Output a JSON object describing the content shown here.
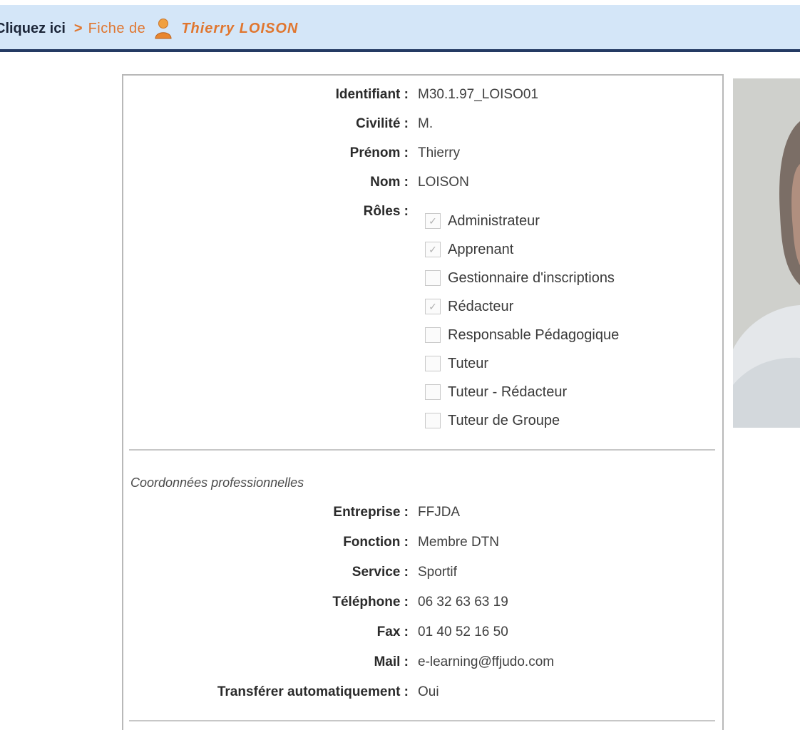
{
  "breadcrumb": {
    "link_label": "Cliquez ici",
    "separator": ">",
    "prefix": "Fiche de",
    "user_name": "Thierry LOISON",
    "user_icon": "user-icon"
  },
  "identity": {
    "identifiant_label": "Identifiant :",
    "identifiant_value": "M30.1.97_LOISO01",
    "civilite_label": "Civilité :",
    "civilite_value": "M.",
    "prenom_label": "Prénom :",
    "prenom_value": "Thierry",
    "nom_label": "Nom :",
    "nom_value": "LOISON",
    "roles_label": "Rôles :"
  },
  "roles": [
    {
      "label": "Administrateur",
      "checked": true
    },
    {
      "label": "Apprenant",
      "checked": true
    },
    {
      "label": "Gestionnaire d'inscriptions",
      "checked": false
    },
    {
      "label": "Rédacteur",
      "checked": true
    },
    {
      "label": "Responsable Pédagogique",
      "checked": false
    },
    {
      "label": "Tuteur",
      "checked": false
    },
    {
      "label": "Tuteur - Rédacteur",
      "checked": false
    },
    {
      "label": "Tuteur de Groupe",
      "checked": false
    }
  ],
  "pro": {
    "section_title": "Coordonnées professionnelles",
    "entreprise_label": "Entreprise :",
    "entreprise_value": "FFJDA",
    "fonction_label": "Fonction :",
    "fonction_value": "Membre DTN",
    "service_label": "Service :",
    "service_value": "Sportif",
    "telephone_label": "Téléphone :",
    "telephone_value": "06 32 63 63 19",
    "fax_label": "Fax :",
    "fax_value": "01 40 52 16 50",
    "mail_label": "Mail :",
    "mail_value": "e-learning@ffjudo.com",
    "transfert_label": "Transférer automatiquement :",
    "transfert_value": "Oui"
  },
  "colors": {
    "header_bg": "#d4e6f8",
    "header_border": "#243a63",
    "accent_orange": "#e0762f"
  }
}
